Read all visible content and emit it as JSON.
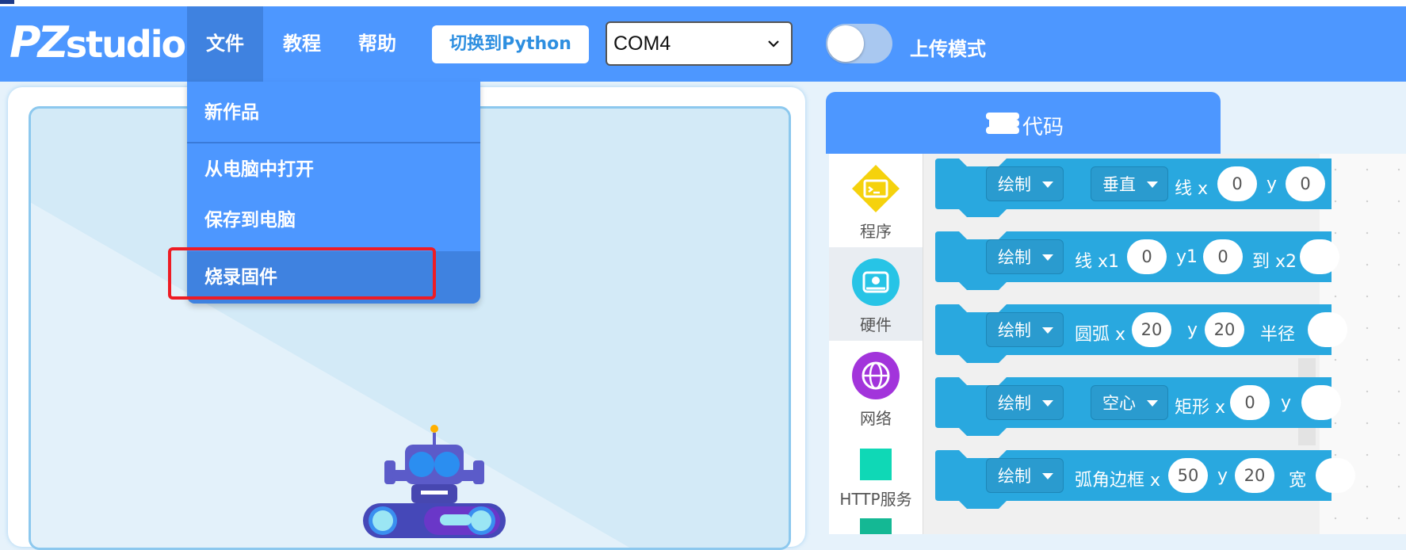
{
  "app": {
    "logo_pz": "PZ",
    "logo_studio": "studio"
  },
  "menu": {
    "file": "文件",
    "tutorial": "教程",
    "help": "帮助"
  },
  "switch_button": "切换到Python",
  "port_select": {
    "value": "COM4"
  },
  "upload_mode": {
    "label": "上传模式",
    "on": false
  },
  "file_menu": {
    "items": [
      {
        "label": "新作品"
      },
      {
        "label": "从电脑中打开"
      },
      {
        "label": "保存到电脑"
      },
      {
        "label": "烧录固件",
        "highlighted": true
      }
    ]
  },
  "code_tab": {
    "label": "代码",
    "icon": "code-icon"
  },
  "categories": [
    {
      "label": "程序",
      "color": "#f5d20d",
      "icon": "terminal-icon"
    },
    {
      "label": "硬件",
      "color": "#27c4e6",
      "icon": "device-icon"
    },
    {
      "label": "网络",
      "color": "#a234db",
      "icon": "globe-icon"
    },
    {
      "label": "HTTP服务",
      "color": "#0fd8b6",
      "icon": "square-icon"
    }
  ],
  "blocks": [
    {
      "dd1": "绘制",
      "dd2": "垂直",
      "t1": "线 x",
      "v1": "0",
      "t2": "y",
      "v2": "0"
    },
    {
      "dd1": "绘制",
      "t1": "线 x1",
      "v1": "0",
      "t2": "y1",
      "v2": "0",
      "t3": "到 x2"
    },
    {
      "dd1": "绘制",
      "t1": "圆弧 x",
      "v1": "20",
      "t2": "y",
      "v2": "20",
      "t3": "半径"
    },
    {
      "dd1": "绘制",
      "dd2": "空心",
      "t1": "矩形 x",
      "v1": "0",
      "t2": "y"
    },
    {
      "dd1": "绘制",
      "t1": "弧角边框 x",
      "v1": "50",
      "t2": "y",
      "v2": "20",
      "t3": "宽"
    }
  ]
}
